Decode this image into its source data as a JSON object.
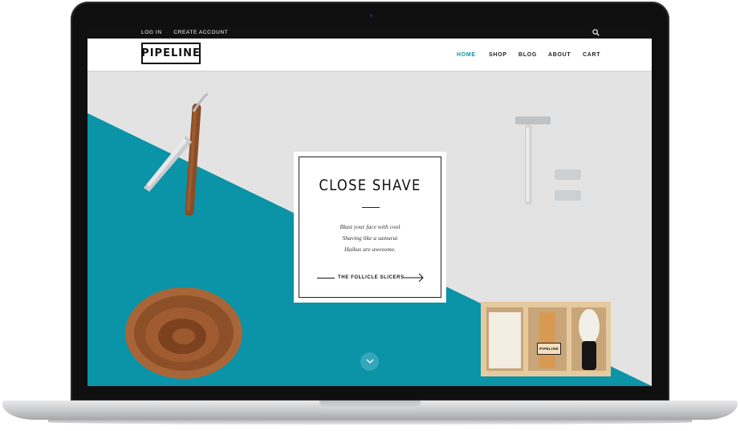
{
  "topbar": {
    "login": "LOG IN",
    "separator": "·",
    "create_account": "CREATE ACCOUNT"
  },
  "brand": {
    "logo": "PIPELINE"
  },
  "nav": {
    "items": [
      {
        "label": "HOME",
        "active": true
      },
      {
        "label": "SHOP",
        "active": false
      },
      {
        "label": "BLOG",
        "active": false
      },
      {
        "label": "ABOUT",
        "active": false
      },
      {
        "label": "CART",
        "active": false
      }
    ]
  },
  "hero": {
    "title": "CLOSE SHAVE",
    "lines": [
      "Blast your face with cool",
      "Shaving like a samurai",
      "Haikus are awesome."
    ],
    "cta": "THE FOLLICLE SLICERS",
    "kit_label": "PIPELINE"
  },
  "icons": {
    "search": "search-icon",
    "arrow": "arrow-right-icon",
    "scroll": "chevron-down-icon"
  },
  "colors": {
    "accent": "#0f8fa6",
    "teal_panel": "#0b93a7",
    "background": "#e3e3e4"
  }
}
